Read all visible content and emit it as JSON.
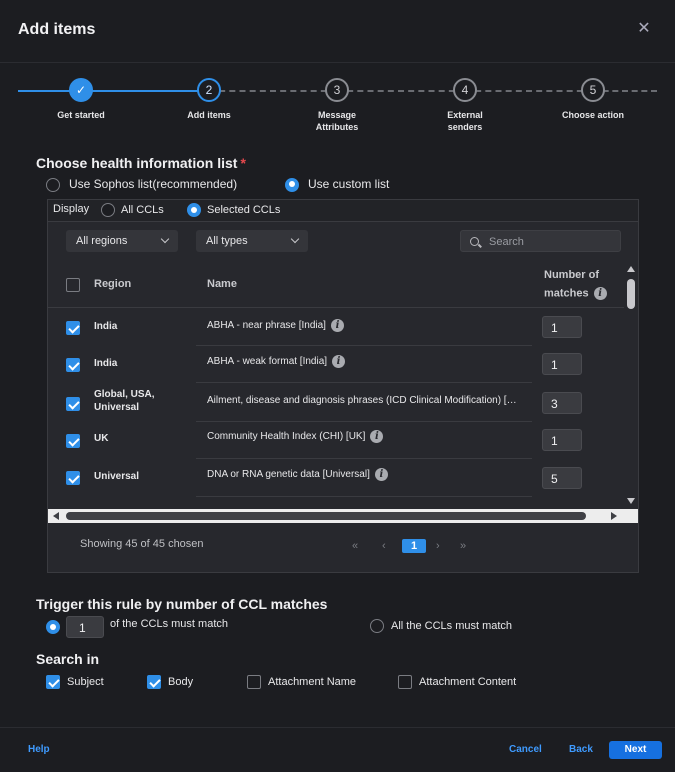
{
  "dialog": {
    "title": "Add items",
    "close_icon": "close-icon"
  },
  "stepper": {
    "steps": [
      {
        "number": "1",
        "label": "Get started",
        "state": "done"
      },
      {
        "number": "2",
        "label": "Add items",
        "state": "active"
      },
      {
        "number": "3",
        "label": "Message Attributes",
        "state": "todo"
      },
      {
        "number": "4",
        "label": "External senders",
        "state": "todo"
      },
      {
        "number": "5",
        "label": "Choose action",
        "state": "todo"
      }
    ]
  },
  "health_list": {
    "title": "Choose health information list",
    "required_mark": "*",
    "option_sophos": "Use Sophos list(recommended)",
    "option_custom": "Use custom list",
    "selected": "custom"
  },
  "display": {
    "label": "Display",
    "option_all": "All CCLs",
    "option_selected": "Selected CCLs",
    "selected": "selected"
  },
  "filters": {
    "regions": "All regions",
    "types": "All types",
    "search_placeholder": "Search"
  },
  "table": {
    "headers": {
      "region": "Region",
      "name": "Name",
      "matches_line1": "Number of",
      "matches_line2": "matches"
    },
    "rows": [
      {
        "checked": true,
        "region": "India",
        "name": "ABHA - near phrase [India]",
        "matches": "1"
      },
      {
        "checked": true,
        "region": "India",
        "name": "ABHA - weak format [India]",
        "matches": "1"
      },
      {
        "checked": true,
        "region": "Global, USA, Universal",
        "name": "Ailment, disease and diagnosis phrases (ICD Clinical Modification) [Un....",
        "matches": "3"
      },
      {
        "checked": true,
        "region": "UK",
        "name": "Community Health Index (CHI) [UK]",
        "matches": "1"
      },
      {
        "checked": true,
        "region": "Universal",
        "name": "DNA or RNA genetic data [Universal]",
        "matches": "5"
      }
    ]
  },
  "pagination": {
    "summary": "Showing 45 of 45 chosen",
    "first": "«",
    "prev": "‹",
    "current": "1",
    "next": "›",
    "last": "»"
  },
  "trigger": {
    "title": "Trigger this rule by number of CCL matches",
    "count_value": "1",
    "option_count": "of the CCLs must match",
    "option_all": "All the CCLs must match",
    "selected": "count"
  },
  "search_in": {
    "title": "Search in",
    "options": [
      {
        "label": "Subject",
        "checked": true
      },
      {
        "label": "Body",
        "checked": true
      },
      {
        "label": "Attachment Name",
        "checked": false
      },
      {
        "label": "Attachment Content",
        "checked": false
      }
    ]
  },
  "footer": {
    "help": "Help",
    "cancel": "Cancel",
    "back": "Back",
    "next": "Next"
  },
  "colors": {
    "accent": "#2f8fe8",
    "primary_button": "#1670e0",
    "required": "#e5484d",
    "background": "#1c1d21"
  }
}
